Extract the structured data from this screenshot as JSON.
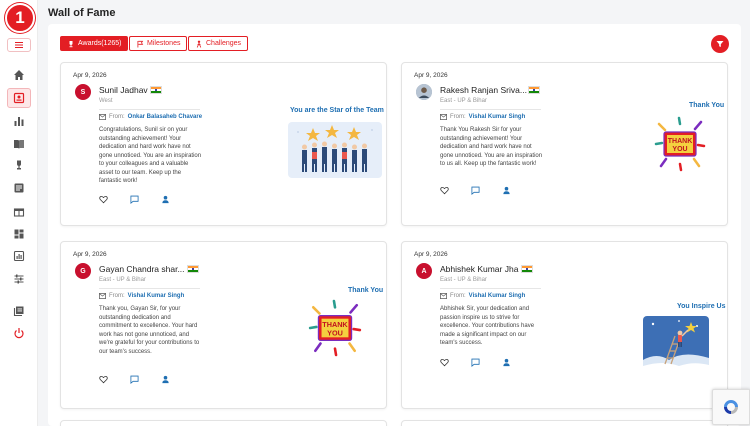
{
  "app": {
    "logo_text": "1",
    "title": "Wall of Fame"
  },
  "sidebar": {
    "items": [
      {
        "name": "home-icon"
      },
      {
        "name": "wall-of-fame-icon",
        "active": true
      },
      {
        "name": "bar-chart-icon"
      },
      {
        "name": "book-icon"
      },
      {
        "name": "trophy-icon"
      },
      {
        "name": "list-icon"
      },
      {
        "name": "gift-icon"
      },
      {
        "name": "dashboard-icon"
      },
      {
        "name": "analytics-icon"
      },
      {
        "name": "settings-sliders-icon"
      },
      {
        "name": "library-icon"
      },
      {
        "name": "power-icon"
      }
    ]
  },
  "tabs": [
    {
      "label": "Awards(1265)",
      "active": true,
      "icon": "trophy-icon"
    },
    {
      "label": "Milestones",
      "active": false,
      "icon": "flag-icon"
    },
    {
      "label": "Challenges",
      "active": false,
      "icon": "person-icon"
    }
  ],
  "colors": {
    "accent": "#e31e24",
    "link": "#1f6fb2"
  },
  "cards": [
    {
      "date": "Apr 9, 2026",
      "initial": "S",
      "name": "Sunil Jadhav",
      "region": "West",
      "from_label": "From:",
      "sender": "Onkar Balasaheb Chavare",
      "message": "Congratulations, Sunil sir on your outstanding achievement! Your dedication and hard work have not gone unnoticed. You are an inspiration to your colleagues and a valuable asset to our team. Keep up the fantastic work!",
      "award": "You are the Star of the Team"
    },
    {
      "date": "Apr 9, 2026",
      "initial": "",
      "name": "Rakesh Ranjan Sriva...",
      "region": "East - UP & Bihar",
      "from_label": "From:",
      "sender": "Vishal Kumar Singh",
      "message": "Thank You Rakesh Sir for your outstanding achievement! Your dedication and hard work have not gone unnoticed. You are an inspiration to us all. Keep up the fantastic work!",
      "award": "Thank You"
    },
    {
      "date": "Apr 9, 2026",
      "initial": "G",
      "name": "Gayan Chandra shar...",
      "region": "East - UP & Bihar",
      "from_label": "From:",
      "sender": "Vishal Kumar Singh",
      "message": "Thank you, Gayan Sir, for your outstanding dedication and commitment to excellence. Your hard work has not gone unnoticed, and we're grateful for your contributions to our team's success.",
      "award": "Thank You"
    },
    {
      "date": "Apr 9, 2026",
      "initial": "A",
      "name": "Abhishek Kumar Jha",
      "region": "East - UP & Bihar",
      "from_label": "From:",
      "sender": "Vishal Kumar Singh",
      "message": "Abhishek Sir, your dedication and passion inspire us to strive for excellence. Your contributions have made a significant impact on our team's success.",
      "award": "You Inspire Us"
    }
  ],
  "badge_text": {
    "thank_you_line1": "THANK",
    "thank_you_line2": "YOU"
  }
}
